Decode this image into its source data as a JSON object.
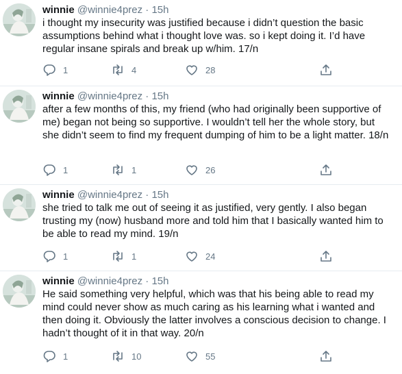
{
  "icons": {
    "reply": "reply-icon",
    "retweet": "retweet-icon",
    "like": "heart-icon",
    "share": "share-icon",
    "avatar": "avatar-photo"
  },
  "colors": {
    "text": "#14171a",
    "secondary": "#657786",
    "divider": "#e6ecf0"
  },
  "tweets": [
    {
      "name": "winnie",
      "handle": "@winnie4prez",
      "dot": "·",
      "time": "15h",
      "text": "i thought my insecurity was justified because i didn’t question the basic assumptions behind what i thought love was. so i kept doing it. I’d have regular insane spirals and break up w/him. 17/n",
      "replies": "1",
      "retweets": "4",
      "likes": "28"
    },
    {
      "name": "winnie",
      "handle": "@winnie4prez",
      "dot": "·",
      "time": "15h",
      "text": "after a few months of this, my friend (who had originally been supportive of me) began not being so supportive. I wouldn’t tell her the whole story, but she didn’t seem to find my frequent dumping of him to be a light matter. 18/n",
      "replies": "1",
      "retweets": "1",
      "likes": "26"
    },
    {
      "name": "winnie",
      "handle": "@winnie4prez",
      "dot": "·",
      "time": "15h",
      "text": "she tried to talk me out of seeing it as justified, very gently. I also began trusting my (now) husband more and told him that I basically wanted him to be able to read my mind. 19/n",
      "replies": "1",
      "retweets": "1",
      "likes": "24"
    },
    {
      "name": "winnie",
      "handle": "@winnie4prez",
      "dot": "·",
      "time": "15h",
      "text": "He said something very helpful, which was that his being able to read my mind could never show as much caring as his learning what i wanted and then doing it. Obviously the latter involves a conscious decision to change. I hadn’t thought of it in that way. 20/n",
      "replies": "1",
      "retweets": "10",
      "likes": "55"
    }
  ]
}
